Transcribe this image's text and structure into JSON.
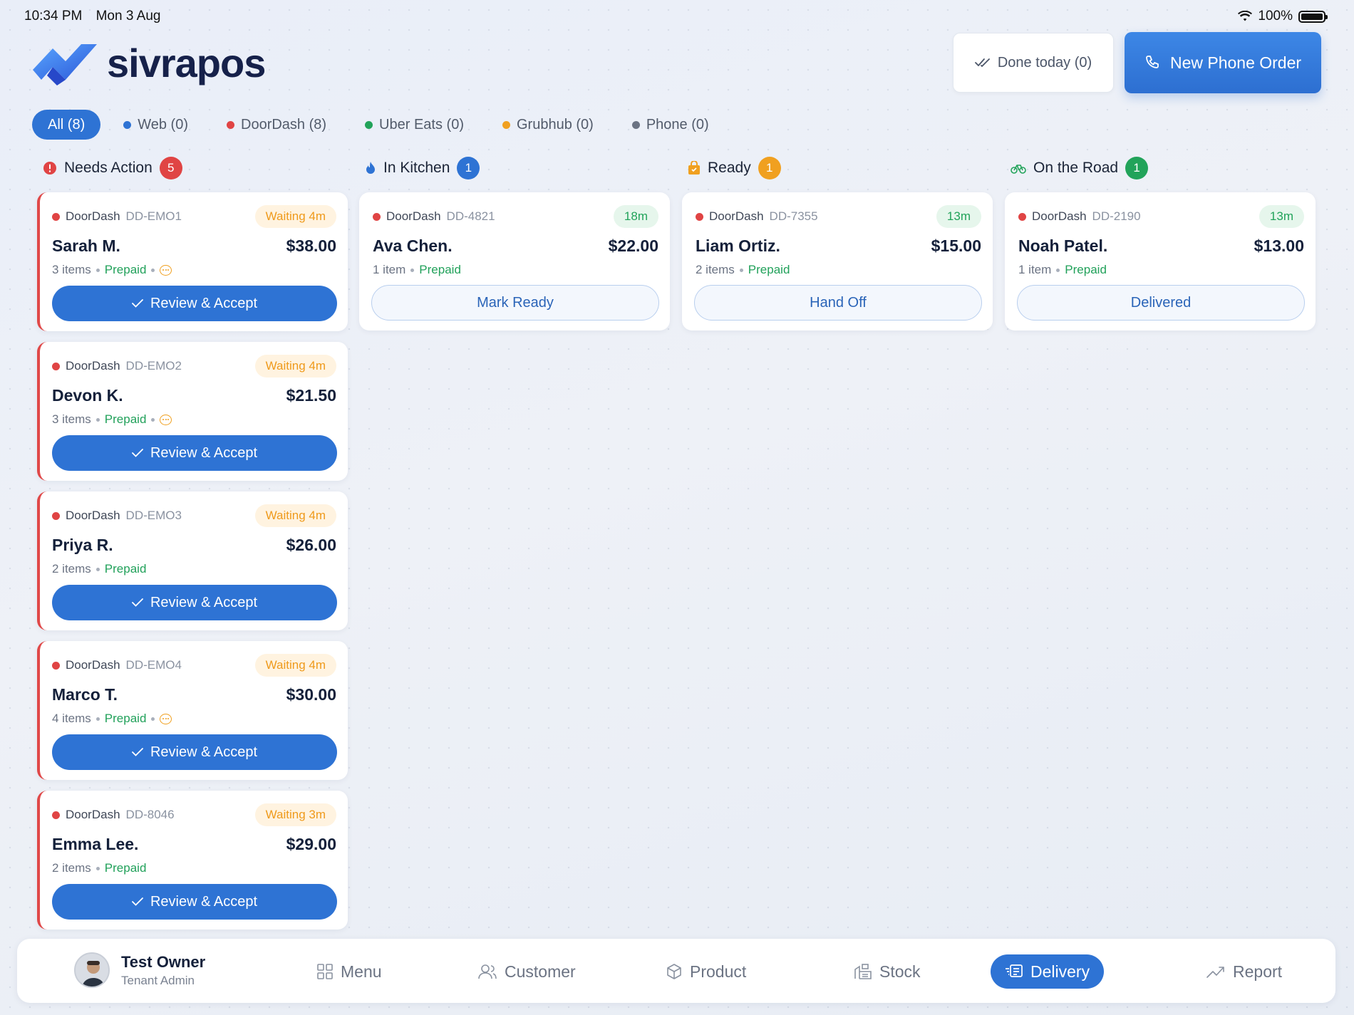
{
  "status_bar": {
    "time": "10:34 PM",
    "date": "Mon 3 Aug",
    "battery": "100%"
  },
  "brand": {
    "name": "sivrapos"
  },
  "header": {
    "done_today": "Done today (0)",
    "new_phone_order": "New Phone Order"
  },
  "filters": [
    {
      "label": "All (8)",
      "color": null,
      "active": true
    },
    {
      "label": "Web (0)",
      "color": "#2e73d4"
    },
    {
      "label": "DoorDash (8)",
      "color": "#e04444"
    },
    {
      "label": "Uber Eats (0)",
      "color": "#22a35a"
    },
    {
      "label": "Grubhub (0)",
      "color": "#f0a020"
    },
    {
      "label": "Phone (0)",
      "color": "#6b7383"
    }
  ],
  "columns": {
    "needs_action": {
      "title": "Needs Action",
      "count": "5",
      "color": "#e04444",
      "orders": [
        {
          "source": "DoorDash",
          "id": "DD-EMO1",
          "badge": "Waiting 4m",
          "name": "Sarah M.",
          "price": "$38.00",
          "items": "3 items",
          "payment": "Prepaid",
          "note": true,
          "action": "Review & Accept"
        },
        {
          "source": "DoorDash",
          "id": "DD-EMO2",
          "badge": "Waiting 4m",
          "name": "Devon K.",
          "price": "$21.50",
          "items": "3 items",
          "payment": "Prepaid",
          "note": true,
          "action": "Review & Accept"
        },
        {
          "source": "DoorDash",
          "id": "DD-EMO3",
          "badge": "Waiting 4m",
          "name": "Priya R.",
          "price": "$26.00",
          "items": "2 items",
          "payment": "Prepaid",
          "note": false,
          "action": "Review & Accept"
        },
        {
          "source": "DoorDash",
          "id": "DD-EMO4",
          "badge": "Waiting 4m",
          "name": "Marco T.",
          "price": "$30.00",
          "items": "4 items",
          "payment": "Prepaid",
          "note": true,
          "action": "Review & Accept"
        },
        {
          "source": "DoorDash",
          "id": "DD-8046",
          "badge": "Waiting 3m",
          "name": "Emma Lee.",
          "price": "$29.00",
          "items": "2 items",
          "payment": "Prepaid",
          "note": false,
          "action": "Review & Accept"
        }
      ]
    },
    "in_kitchen": {
      "title": "In Kitchen",
      "count": "1",
      "color": "#2e73d4",
      "orders": [
        {
          "source": "DoorDash",
          "id": "DD-4821",
          "badge": "18m",
          "name": "Ava Chen.",
          "price": "$22.00",
          "items": "1 item",
          "payment": "Prepaid",
          "action": "Mark Ready"
        }
      ]
    },
    "ready": {
      "title": "Ready",
      "count": "1",
      "color": "#f0a020",
      "orders": [
        {
          "source": "DoorDash",
          "id": "DD-7355",
          "badge": "13m",
          "name": "Liam Ortiz.",
          "price": "$15.00",
          "items": "2 items",
          "payment": "Prepaid",
          "action": "Hand Off"
        }
      ]
    },
    "on_the_road": {
      "title": "On the Road",
      "count": "1",
      "color": "#22a35a",
      "orders": [
        {
          "source": "DoorDash",
          "id": "DD-2190",
          "badge": "13m",
          "name": "Noah Patel.",
          "price": "$13.00",
          "items": "1 item",
          "payment": "Prepaid",
          "action": "Delivered"
        }
      ]
    }
  },
  "bottom_nav": {
    "user": {
      "name": "Test Owner",
      "role": "Tenant Admin"
    },
    "items": [
      {
        "label": "Menu",
        "icon": "grid-icon"
      },
      {
        "label": "Customer",
        "icon": "users-icon"
      },
      {
        "label": "Product",
        "icon": "box-icon"
      },
      {
        "label": "Stock",
        "icon": "warehouse-icon"
      },
      {
        "label": "Delivery",
        "icon": "delivery-icon",
        "active": true
      },
      {
        "label": "Report",
        "icon": "trend-icon"
      }
    ]
  }
}
